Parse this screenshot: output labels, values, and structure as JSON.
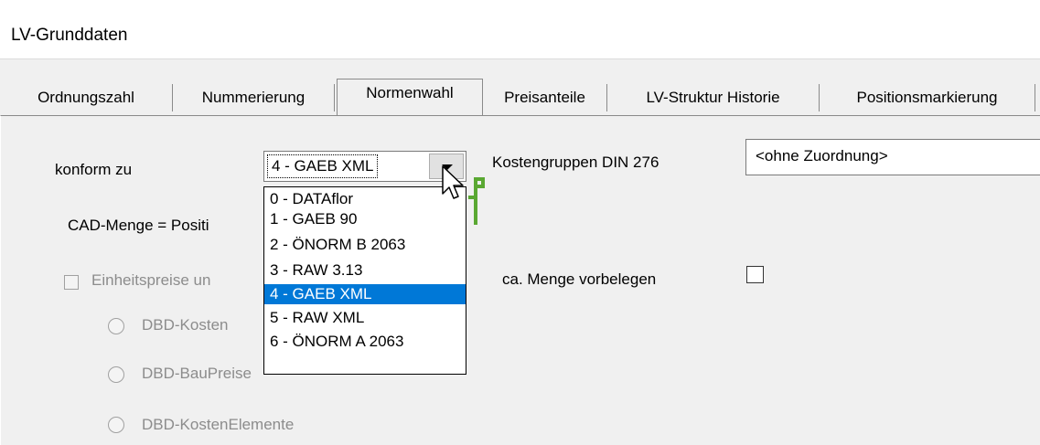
{
  "window": {
    "title": "LV-Grunddaten"
  },
  "tabs": [
    {
      "label": "Ordnungszahl",
      "active": false
    },
    {
      "label": "Nummerierung",
      "active": false
    },
    {
      "label": "Normenwahl",
      "active": true
    },
    {
      "label": "Preisanteile",
      "active": false
    },
    {
      "label": "LV-Struktur Historie",
      "active": false
    },
    {
      "label": "Positionsmarkierung",
      "active": false
    }
  ],
  "form": {
    "konform_label": "konform zu",
    "konform_value": "4 - GAEB XML",
    "kostengruppen_label": "Kostengruppen DIN 276",
    "kostengruppen_value": "<ohne Zuordnung>",
    "cad_menge_label": "CAD-Menge = Positi",
    "einheitspreise_label": "Einheitspreise un",
    "ca_menge_label": "ca. Menge vorbelegen",
    "radio_1": "DBD-Kosten",
    "radio_2": "DBD-BauPreise",
    "radio_3": "DBD-KostenElemente"
  },
  "dropdown": {
    "options": [
      "0 - DATAflor",
      "1 - GAEB 90",
      "2 - ÖNORM B 2063",
      "3 - RAW 3.13",
      "4 - GAEB XML",
      "5 - RAW XML",
      "6 - ÖNORM A 2063"
    ],
    "selected_index": 4
  },
  "colors": {
    "selection": "#0078d7",
    "icon_green": "#5aa832"
  },
  "icons": [
    "combo-arrow-icon",
    "mouse-cursor-icon",
    "green-flag-icon"
  ]
}
